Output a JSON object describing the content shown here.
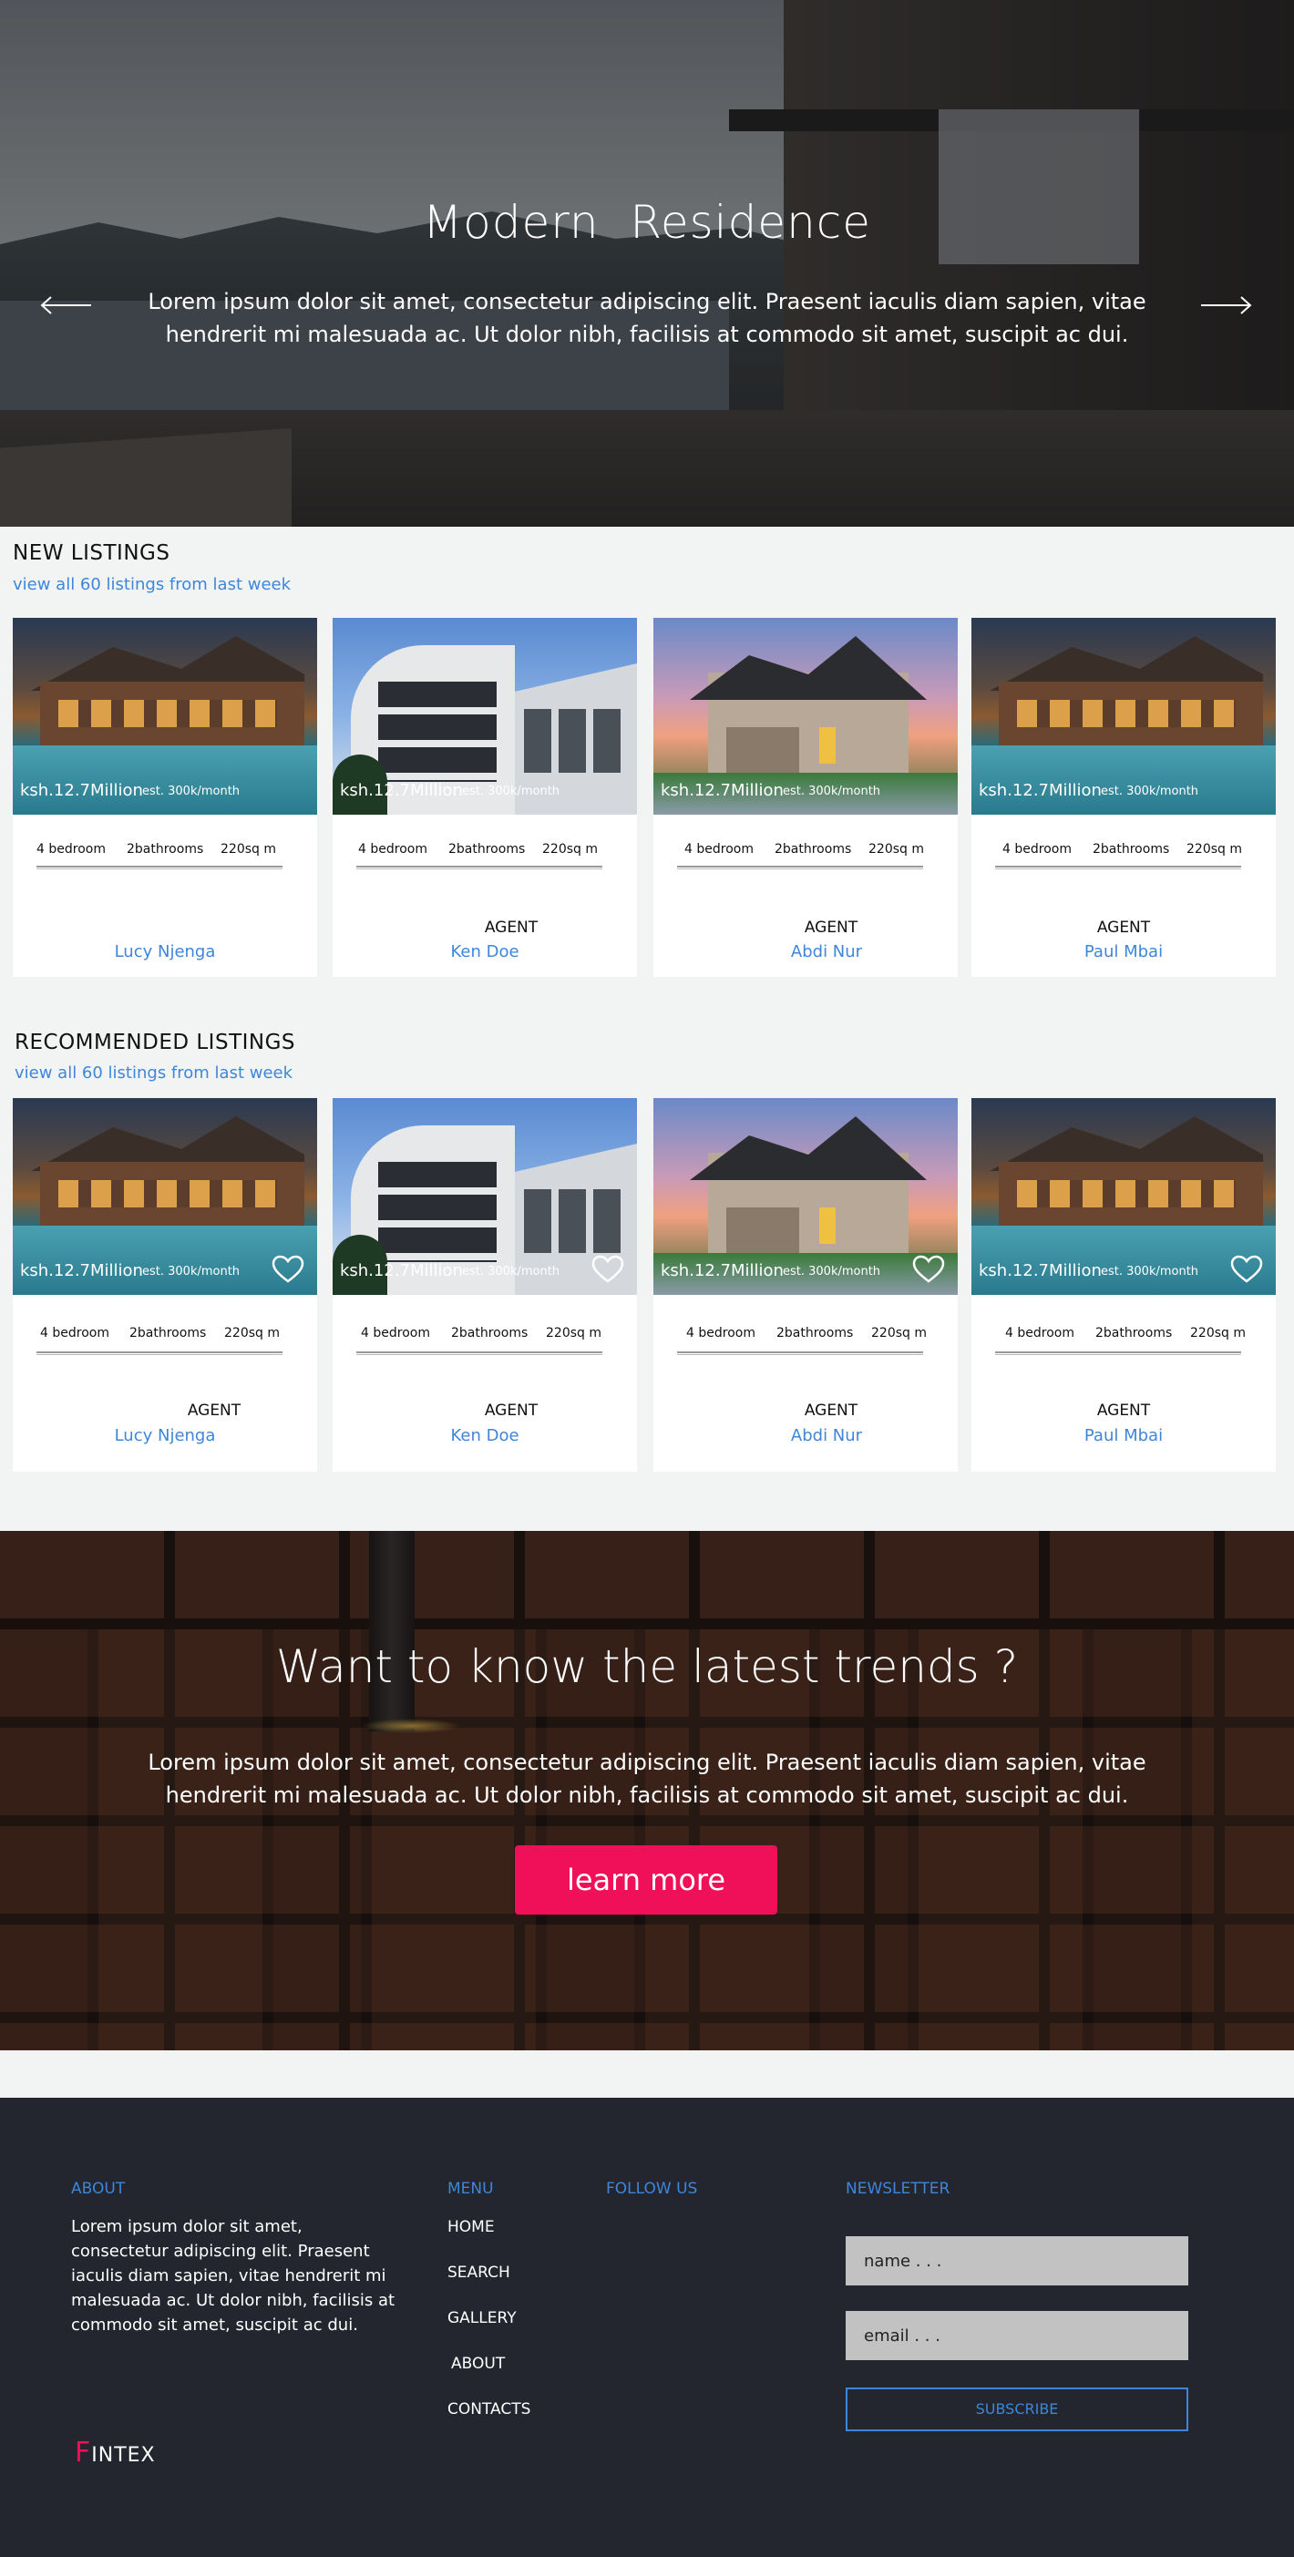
{
  "hero": {
    "title": "Modern  Residence",
    "text": "Lorem ipsum dolor sit amet, consectetur adipiscing elit. Praesent iaculis diam sapien, vitae hendrerit mi malesuada ac. Ut dolor nibh, facilisis at commodo sit amet, suscipit ac dui.",
    "prev_icon": "arrow-left-icon",
    "next_icon": "arrow-right-icon"
  },
  "new_listings": {
    "title": "NEW LISTINGS",
    "link": "view all 60 listings from last week",
    "cards": [
      {
        "image": "pool-house",
        "price": "ksh.12.7Million",
        "est": "est. 300k/month",
        "bedrooms": "4 bedroom",
        "bathrooms": "2bathrooms",
        "area": "220sq m",
        "agent_label": "",
        "agent": "Lucy  Njenga"
      },
      {
        "image": "modern-house",
        "price": "ksh.12.7Million",
        "est": "est. 300k/month",
        "bedrooms": "4 bedroom",
        "bathrooms": "2bathrooms",
        "area": "220sq m",
        "agent_label": "AGENT",
        "agent": "Ken Doe"
      },
      {
        "image": "suburban-house",
        "price": "ksh.12.7Million",
        "est": "est. 300k/month",
        "bedrooms": "4 bedroom",
        "bathrooms": "2bathrooms",
        "area": "220sq m",
        "agent_label": "AGENT",
        "agent": "Abdi Nur"
      },
      {
        "image": "pool-house",
        "price": "ksh.12.7Million",
        "est": "est. 300k/month",
        "bedrooms": "4 bedroom",
        "bathrooms": "2bathrooms",
        "area": "220sq m",
        "agent_label": "AGENT",
        "agent": "Paul Mbai"
      }
    ]
  },
  "recommended_listings": {
    "title": "RECOMMENDED LISTINGS",
    "link": "view all 60 listings from last week",
    "cards": [
      {
        "image": "pool-house",
        "price": "ksh.12.7Million",
        "est": "est. 300k/month",
        "bedrooms": "4 bedroom",
        "bathrooms": "2bathrooms",
        "area": "220sq m",
        "agent_label": "AGENT",
        "agent": "Lucy  Njenga",
        "icon": "heart-icon"
      },
      {
        "image": "modern-house",
        "price": "ksh.12.7Million",
        "est": "est. 300k/month",
        "bedrooms": "4 bedroom",
        "bathrooms": "2bathrooms",
        "area": "220sq m",
        "agent_label": "AGENT",
        "agent": "Ken Doe",
        "icon": "heart-icon"
      },
      {
        "image": "suburban-house",
        "price": "ksh.12.7Million",
        "est": "est. 300k/month",
        "bedrooms": "4 bedroom",
        "bathrooms": "2bathrooms",
        "area": "220sq m",
        "agent_label": "AGENT",
        "agent": "Abdi Nur",
        "icon": "heart-icon"
      },
      {
        "image": "pool-house",
        "price": "ksh.12.7Million",
        "est": "est. 300k/month",
        "bedrooms": "4 bedroom",
        "bathrooms": "2bathrooms",
        "area": "220sq m",
        "agent_label": "AGENT",
        "agent": "Paul Mbai",
        "icon": "heart-icon"
      }
    ]
  },
  "trends": {
    "title": "Want to know the latest trends ?",
    "text": "Lorem ipsum dolor sit amet, consectetur adipiscing elit. Praesent iaculis diam sapien, vitae hendrerit mi malesuada ac. Ut dolor nibh, facilisis at commodo sit amet, suscipit ac dui.",
    "button": "learn more"
  },
  "footer": {
    "about_heading": "ABOUT",
    "about_text": "Lorem ipsum dolor sit amet, consectetur adipiscing elit. Praesent iaculis diam sapien, vitae hendrerit mi malesuada ac. Ut dolor nibh, facilisis at commodo sit amet, suscipit ac dui.",
    "menu_heading": "MENU",
    "menu_items": [
      "HOME",
      "SEARCH",
      "GALLERY",
      "ABOUT",
      "CONTACTS"
    ],
    "follow_heading": "FOLLOW US",
    "newsletter_heading": "NEWSLETTER",
    "name_placeholder": "name . . .",
    "email_placeholder": "email . . .",
    "subscribe": "SUBSCRIBE",
    "logo_initial": "F",
    "logo_rest": "INTEX"
  },
  "colors": {
    "accent_blue": "#3d86d9",
    "accent_pink": "#f0105a",
    "footer_bg": "#23262e",
    "page_bg": "#f2f4f4"
  }
}
